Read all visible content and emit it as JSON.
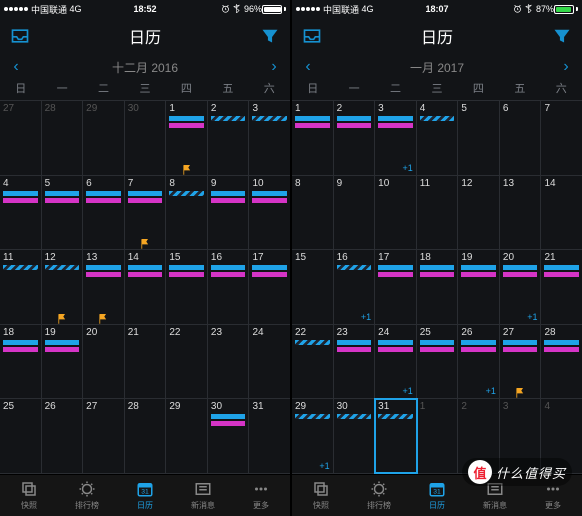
{
  "watermark": {
    "char": "值",
    "text": "什么值得买"
  },
  "tabs": {
    "snap": "快照",
    "rank": "排行榜",
    "cal": "日历",
    "msg": "新消息",
    "more": "更多"
  },
  "weekdays": [
    "日",
    "一",
    "二",
    "三",
    "四",
    "五",
    "六"
  ],
  "nav_title": "日历",
  "extra_label": "+1",
  "phones": [
    {
      "status": {
        "carrier": "中国联通",
        "net": "4G",
        "time": "18:52",
        "batt": "96%",
        "green": false
      },
      "month": "十二月 2016",
      "active_tab": 2,
      "cells": [
        [
          {
            "n": "27",
            "dim": true
          },
          {
            "n": "28",
            "dim": true
          },
          {
            "n": "29",
            "dim": true
          },
          {
            "n": "30",
            "dim": true
          },
          {
            "n": "1",
            "bars": [
              "blue",
              "pink"
            ],
            "flag": true
          },
          {
            "n": "2",
            "bars": [
              "hatch"
            ]
          },
          {
            "n": "3",
            "bars": [
              "hatch"
            ]
          }
        ],
        [
          {
            "n": "4",
            "bars": [
              "blue",
              "pink"
            ]
          },
          {
            "n": "5",
            "bars": [
              "blue",
              "pink"
            ]
          },
          {
            "n": "6",
            "bars": [
              "blue",
              "pink"
            ]
          },
          {
            "n": "7",
            "bars": [
              "blue",
              "pink"
            ],
            "flag": true
          },
          {
            "n": "8",
            "bars": [
              "hatch"
            ]
          },
          {
            "n": "9",
            "bars": [
              "blue",
              "pink"
            ]
          },
          {
            "n": "10",
            "bars": [
              "blue",
              "pink"
            ]
          }
        ],
        [
          {
            "n": "11",
            "bars": [
              "hatch"
            ]
          },
          {
            "n": "12",
            "bars": [
              "hatch"
            ],
            "flag": true
          },
          {
            "n": "13",
            "bars": [
              "blue",
              "pink"
            ],
            "flag": true
          },
          {
            "n": "14",
            "bars": [
              "blue",
              "pink"
            ]
          },
          {
            "n": "15",
            "bars": [
              "blue",
              "pink"
            ]
          },
          {
            "n": "16",
            "bars": [
              "blue",
              "pink"
            ]
          },
          {
            "n": "17",
            "bars": [
              "blue",
              "pink"
            ]
          }
        ],
        [
          {
            "n": "18",
            "bars": [
              "blue",
              "pink"
            ]
          },
          {
            "n": "19",
            "bars": [
              "blue",
              "pink"
            ]
          },
          {
            "n": "20"
          },
          {
            "n": "21"
          },
          {
            "n": "22"
          },
          {
            "n": "23"
          },
          {
            "n": "24"
          }
        ],
        [
          {
            "n": "25"
          },
          {
            "n": "26"
          },
          {
            "n": "27"
          },
          {
            "n": "28"
          },
          {
            "n": "29"
          },
          {
            "n": "30",
            "bars": [
              "blue",
              "pink"
            ]
          },
          {
            "n": "31"
          }
        ]
      ]
    },
    {
      "status": {
        "carrier": "中国联通",
        "net": "4G",
        "time": "18:07",
        "batt": "87%",
        "green": true
      },
      "month": "一月 2017",
      "active_tab": 2,
      "cells": [
        [
          {
            "n": "1",
            "bars": [
              "blue",
              "pink"
            ]
          },
          {
            "n": "2",
            "bars": [
              "blue",
              "pink"
            ]
          },
          {
            "n": "3",
            "bars": [
              "blue",
              "pink"
            ],
            "extra": true
          },
          {
            "n": "4",
            "bars": [
              "hatch"
            ]
          },
          {
            "n": "5"
          },
          {
            "n": "6"
          },
          {
            "n": "7"
          }
        ],
        [
          {
            "n": "8"
          },
          {
            "n": "9"
          },
          {
            "n": "10"
          },
          {
            "n": "11"
          },
          {
            "n": "12"
          },
          {
            "n": "13"
          },
          {
            "n": "14"
          }
        ],
        [
          {
            "n": "15"
          },
          {
            "n": "16",
            "bars": [
              "hatch"
            ],
            "extra": true
          },
          {
            "n": "17",
            "bars": [
              "blue",
              "pink"
            ]
          },
          {
            "n": "18",
            "bars": [
              "blue",
              "pink"
            ]
          },
          {
            "n": "19",
            "bars": [
              "blue",
              "pink"
            ]
          },
          {
            "n": "20",
            "bars": [
              "blue",
              "pink"
            ],
            "extra": true
          },
          {
            "n": "21",
            "bars": [
              "blue",
              "pink"
            ]
          }
        ],
        [
          {
            "n": "22",
            "bars": [
              "hatch"
            ]
          },
          {
            "n": "23",
            "bars": [
              "blue",
              "pink"
            ]
          },
          {
            "n": "24",
            "bars": [
              "blue",
              "pink"
            ],
            "extra": true
          },
          {
            "n": "25",
            "bars": [
              "blue",
              "pink"
            ]
          },
          {
            "n": "26",
            "bars": [
              "blue",
              "pink"
            ],
            "extra": true
          },
          {
            "n": "27",
            "bars": [
              "blue",
              "pink"
            ],
            "flag": true
          },
          {
            "n": "28",
            "bars": [
              "blue",
              "pink"
            ]
          }
        ],
        [
          {
            "n": "29",
            "bars": [
              "hatch"
            ],
            "extra": true
          },
          {
            "n": "30",
            "bars": [
              "hatch"
            ]
          },
          {
            "n": "31",
            "bars": [
              "hatch"
            ],
            "today": true
          },
          {
            "n": "1",
            "dim": true
          },
          {
            "n": "2",
            "dim": true
          },
          {
            "n": "3",
            "dim": true
          },
          {
            "n": "4",
            "dim": true
          }
        ]
      ]
    }
  ]
}
